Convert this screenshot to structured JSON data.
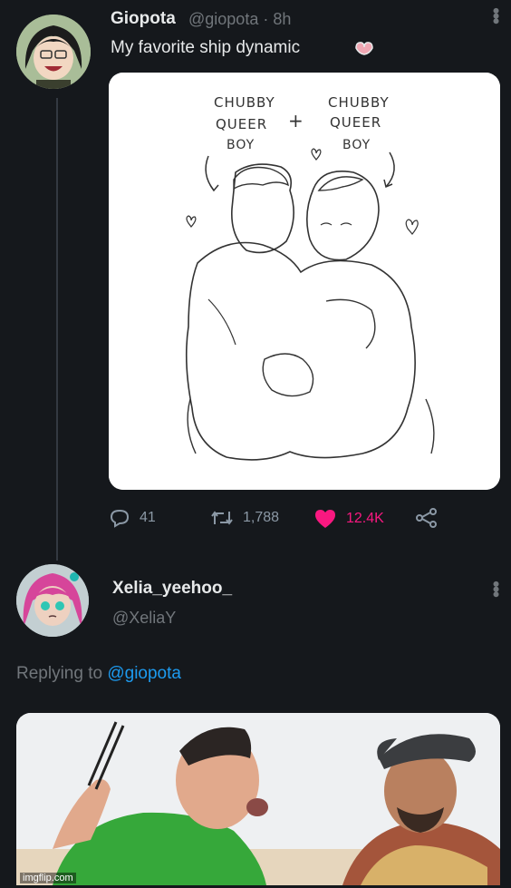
{
  "tweet": {
    "display_name": "Giopota",
    "handle_and_time": "@giopota · 8h",
    "text": "My favorite ship dynamic",
    "text_emoji_icon": "heart-hands-icon",
    "image_text": {
      "left_line1": "CHUBBY",
      "left_line2": "QUEER",
      "left_line3": "BOY",
      "plus": "+",
      "right_line1": "CHUBBY",
      "right_line2": "QUEER",
      "right_line3": "BOY"
    },
    "actions": {
      "reply_count": "41",
      "retweet_count": "1,788",
      "like_count": "12.4K",
      "icons": [
        "reply-icon",
        "retweet-icon",
        "heart-icon",
        "share-icon"
      ],
      "like_color": "#f91880"
    }
  },
  "reply": {
    "display_name": "Xelia_yeehoo_",
    "handle": "@XeliaY",
    "replying_prefix": "Replying to",
    "replying_mention": "@giopota",
    "mention_color": "#1d9bf0"
  },
  "watermark": "imgflip.com"
}
